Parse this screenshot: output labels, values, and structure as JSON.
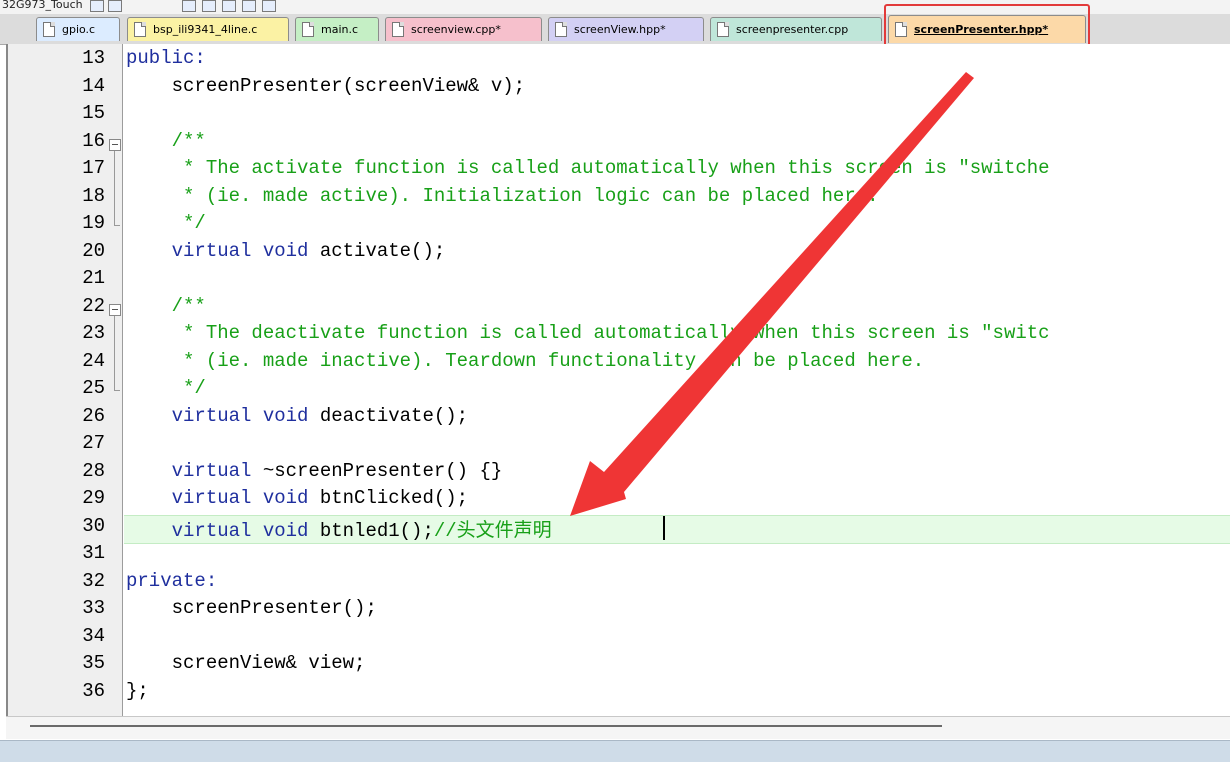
{
  "project_selector": {
    "label": "32G973_Touch"
  },
  "tabs": [
    {
      "label": "gpio.c",
      "color": "#dcecff",
      "active": false
    },
    {
      "label": "bsp_ili9341_4line.c",
      "color": "#fbf2a4",
      "active": false
    },
    {
      "label": "main.c",
      "color": "#c5efc5",
      "active": false
    },
    {
      "label": "screenview.cpp*",
      "color": "#f6c0cc",
      "active": false
    },
    {
      "label": "screenView.hpp*",
      "color": "#d3d0f4",
      "active": false
    },
    {
      "label": "screenpresenter.cpp",
      "color": "#bfe6d9",
      "active": false
    },
    {
      "label": "screenPresenter.hpp*",
      "color": "#fcd9a8",
      "active": true
    }
  ],
  "editor": {
    "highlighted_line": 30,
    "lines": [
      {
        "num": "13",
        "code": [
          {
            "t": "public:",
            "c": "kw"
          }
        ]
      },
      {
        "num": "14",
        "code": [
          {
            "t": "    screenPresenter(screenView& v);",
            "c": ""
          }
        ]
      },
      {
        "num": "15",
        "code": []
      },
      {
        "num": "16",
        "code": [
          {
            "t": "    /**",
            "c": "cm"
          }
        ]
      },
      {
        "num": "17",
        "code": [
          {
            "t": "     * The activate function is called automatically when this screen is \"switche",
            "c": "cm"
          }
        ]
      },
      {
        "num": "18",
        "code": [
          {
            "t": "     * (ie. made active). Initialization logic can be placed here.",
            "c": "cm"
          }
        ]
      },
      {
        "num": "19",
        "code": [
          {
            "t": "     */",
            "c": "cm"
          }
        ]
      },
      {
        "num": "20",
        "code": [
          {
            "t": "    virtual void",
            "c": "kw"
          },
          {
            "t": " activate();",
            "c": ""
          }
        ]
      },
      {
        "num": "21",
        "code": []
      },
      {
        "num": "22",
        "code": [
          {
            "t": "    /**",
            "c": "cm"
          }
        ]
      },
      {
        "num": "23",
        "code": [
          {
            "t": "     * The deactivate function is called automatically when this screen is \"switc",
            "c": "cm"
          }
        ]
      },
      {
        "num": "24",
        "code": [
          {
            "t": "     * (ie. made inactive). Teardown functionality can be placed here.",
            "c": "cm"
          }
        ]
      },
      {
        "num": "25",
        "code": [
          {
            "t": "     */",
            "c": "cm"
          }
        ]
      },
      {
        "num": "26",
        "code": [
          {
            "t": "    virtual void",
            "c": "kw"
          },
          {
            "t": " deactivate();",
            "c": ""
          }
        ]
      },
      {
        "num": "27",
        "code": []
      },
      {
        "num": "28",
        "code": [
          {
            "t": "    virtual",
            "c": "kw"
          },
          {
            "t": " ~screenPresenter() {}",
            "c": ""
          }
        ]
      },
      {
        "num": "29",
        "code": [
          {
            "t": "    virtual void",
            "c": "kw"
          },
          {
            "t": " btnClicked();",
            "c": ""
          }
        ]
      },
      {
        "num": "30",
        "code": [
          {
            "t": "    virtual void",
            "c": "kw"
          },
          {
            "t": " btnled1();",
            "c": ""
          },
          {
            "t": "//头文件声明",
            "c": "cm"
          }
        ]
      },
      {
        "num": "31",
        "code": []
      },
      {
        "num": "32",
        "code": [
          {
            "t": "private:",
            "c": "kw"
          }
        ]
      },
      {
        "num": "33",
        "code": [
          {
            "t": "    screenPresenter();",
            "c": ""
          }
        ]
      },
      {
        "num": "34",
        "code": []
      },
      {
        "num": "35",
        "code": [
          {
            "t": "    screenView& view;",
            "c": ""
          }
        ]
      },
      {
        "num": "36",
        "code": [
          {
            "t": "};",
            "c": ""
          }
        ]
      }
    ]
  },
  "annotation": {
    "box_color": "#e23a3a",
    "arrow_color": "#ef3535"
  }
}
